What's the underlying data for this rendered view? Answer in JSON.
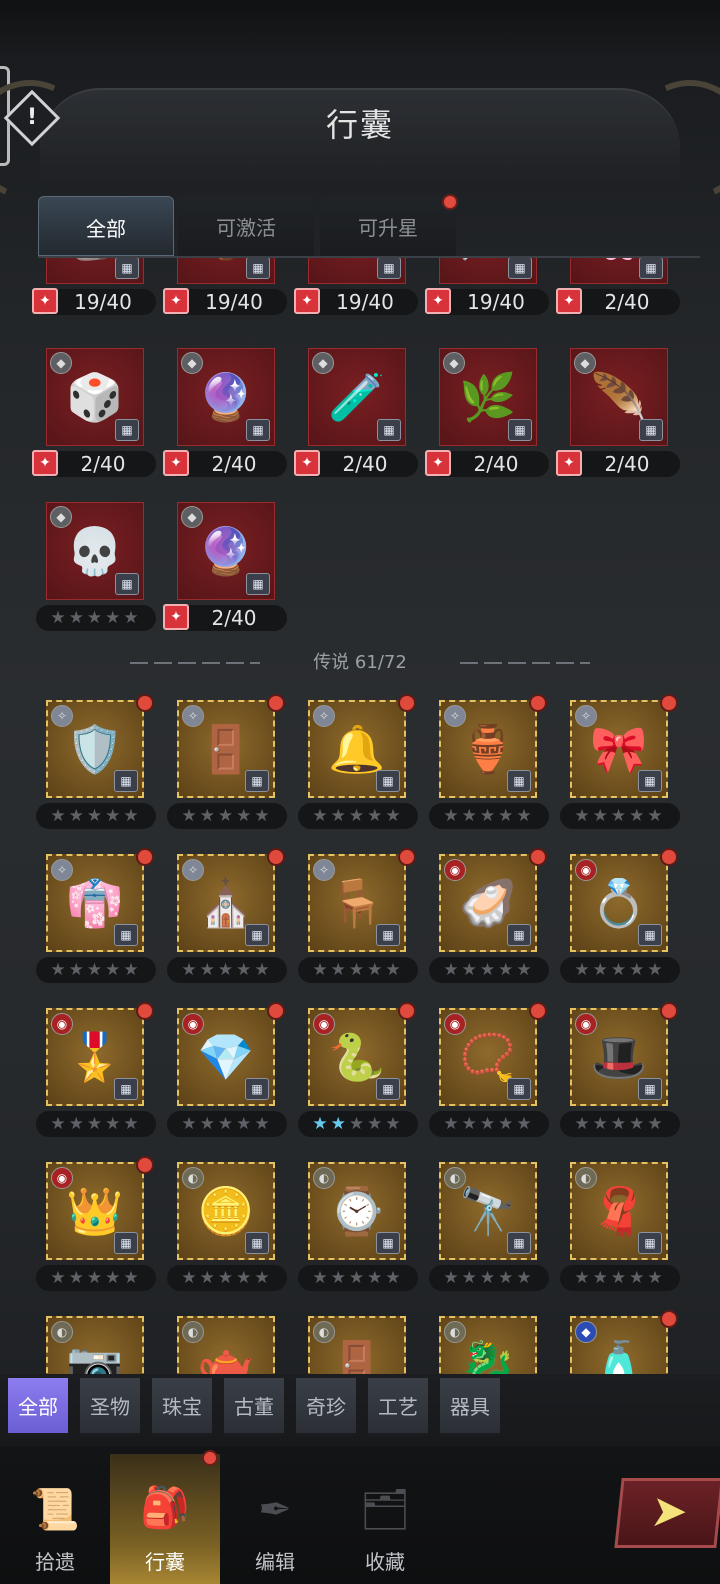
{
  "header": {
    "title": "行囊",
    "info_icon": "exclamation-icon"
  },
  "tabs": [
    {
      "label": "全部",
      "active": true
    },
    {
      "label": "可激活",
      "active": false
    },
    {
      "label": "可升星",
      "active": false,
      "badge": true
    }
  ],
  "row1_partial": [
    {
      "count": "19/40",
      "art": "🗿"
    },
    {
      "count": "19/40",
      "art": "🏺"
    },
    {
      "count": "19/40",
      "art": "💎"
    },
    {
      "count": "19/40",
      "art": "🪄"
    },
    {
      "count": "2/40",
      "art": "🌸"
    }
  ],
  "row2": [
    {
      "count": "2/40",
      "art": "🎲",
      "name": "cube"
    },
    {
      "count": "2/40",
      "art": "🔮",
      "name": "wand"
    },
    {
      "count": "2/40",
      "art": "🧪",
      "name": "potion"
    },
    {
      "count": "2/40",
      "art": "🌿",
      "name": "branch"
    },
    {
      "count": "2/40",
      "art": "🪶",
      "name": "feather"
    }
  ],
  "row3": [
    {
      "stars": "★★★★★",
      "art": "💀",
      "name": "skeleton"
    },
    {
      "count": "2/40",
      "art": "🔮",
      "name": "crystal"
    }
  ],
  "divider": {
    "label": "传说 61/72"
  },
  "legend": [
    [
      {
        "art": "🛡️",
        "grade": "crystal"
      },
      {
        "art": "🚪",
        "grade": "crystal"
      },
      {
        "art": "🔔",
        "grade": "crystal"
      },
      {
        "art": "🏺",
        "grade": "crystal"
      },
      {
        "art": "🎀",
        "grade": "crystal"
      }
    ],
    [
      {
        "art": "👘",
        "grade": "crystal"
      },
      {
        "art": "⛪",
        "grade": "crystal"
      },
      {
        "art": "🪑",
        "grade": "crystal"
      },
      {
        "art": "🦪",
        "grade": "ruby"
      },
      {
        "art": "💍",
        "grade": "ruby"
      }
    ],
    [
      {
        "art": "🎖️",
        "grade": "ruby"
      },
      {
        "art": "💎",
        "grade": "ruby"
      },
      {
        "art": "🐍",
        "grade": "ruby",
        "lit": 2
      },
      {
        "art": "📿",
        "grade": "ruby"
      },
      {
        "art": "🎩",
        "grade": "ruby"
      }
    ],
    [
      {
        "art": "👑",
        "grade": "ruby"
      },
      {
        "art": "🪙",
        "grade": "pot"
      },
      {
        "art": "⌚",
        "grade": "pot"
      },
      {
        "art": "🔭",
        "grade": "pot"
      },
      {
        "art": "🧣",
        "grade": "pot"
      }
    ],
    [
      {
        "art": "📷",
        "grade": "pot"
      },
      {
        "art": "🫖",
        "grade": "pot"
      },
      {
        "art": "🚪",
        "grade": "pot"
      },
      {
        "art": "🐉",
        "grade": "pot"
      },
      {
        "art": "🧴",
        "grade": "sapph"
      }
    ]
  ],
  "legend_badges": [
    [
      true,
      true,
      true,
      true,
      true
    ],
    [
      true,
      true,
      true,
      true,
      true
    ],
    [
      true,
      true,
      true,
      true,
      true
    ],
    [
      true,
      false,
      false,
      false,
      false
    ],
    [
      false,
      false,
      false,
      false,
      true
    ]
  ],
  "categories": [
    "全部",
    "圣物",
    "珠宝",
    "古董",
    "奇珍",
    "工艺",
    "器具"
  ],
  "bottom_nav": [
    {
      "label": "拾遗",
      "icon": "scroll-icon",
      "active": false
    },
    {
      "label": "行囊",
      "icon": "backpack-icon",
      "active": true
    },
    {
      "label": "编辑",
      "icon": "quill-icon",
      "active": false
    },
    {
      "label": "收藏",
      "icon": "collection-icon",
      "active": false
    }
  ],
  "go_button": {
    "icon": "arrow-right-icon"
  }
}
